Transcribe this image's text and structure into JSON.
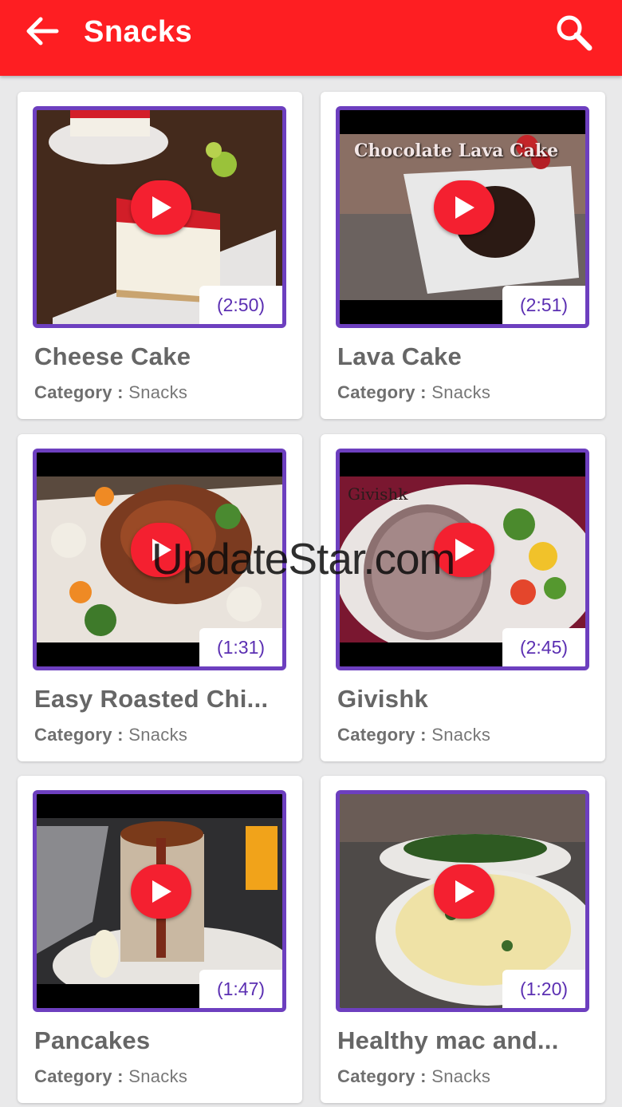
{
  "appbar": {
    "title": "Snacks",
    "back_icon": "arrow-left-icon",
    "search_icon": "search-icon",
    "color": "#fe1e22"
  },
  "watermark": "UpdateStar.com",
  "accent_color": "#6d3fbf",
  "videos": [
    {
      "title": "Cheese Cake",
      "category_label": "Category :",
      "category": "Snacks",
      "duration": "(2:50)"
    },
    {
      "title": "Lava Cake",
      "category_label": "Category :",
      "category": "Snacks",
      "duration": "(2:51)",
      "overlay": "Chocolate Lava Cake"
    },
    {
      "title": "Easy Roasted Chi...",
      "category_label": "Category :",
      "category": "Snacks",
      "duration": "(1:31)"
    },
    {
      "title": "Givishk",
      "category_label": "Category :",
      "category": "Snacks",
      "duration": "(2:45)",
      "overlay": "Givishk"
    },
    {
      "title": "Pancakes",
      "category_label": "Category :",
      "category": "Snacks",
      "duration": "(1:47)"
    },
    {
      "title": "Healthy mac and...",
      "category_label": "Category :",
      "category": "Snacks",
      "duration": "(1:20)"
    }
  ]
}
